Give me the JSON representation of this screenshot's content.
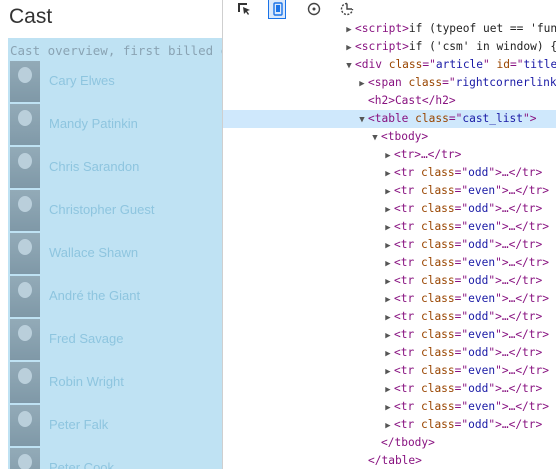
{
  "page": {
    "title": "Cast",
    "caption": "Cast overview, first billed only:",
    "cast": [
      {
        "name": "Cary Elwes"
      },
      {
        "name": "Mandy Patinkin"
      },
      {
        "name": "Chris Sarandon"
      },
      {
        "name": "Christopher Guest"
      },
      {
        "name": "Wallace Shawn"
      },
      {
        "name": "André the Giant"
      },
      {
        "name": "Fred Savage"
      },
      {
        "name": "Robin Wright"
      },
      {
        "name": "Peter Falk"
      },
      {
        "name": "Peter Cook"
      }
    ]
  },
  "devtools": {
    "toolbar": [
      "inspect-element-icon",
      "device-toolbar-icon",
      "performance-icon",
      "memory-icon"
    ],
    "nodes": [
      {
        "indent": 1,
        "expander": "closed",
        "open": "<script>",
        "text": "if (typeof uet == 'fun"
      },
      {
        "indent": 1,
        "expander": "closed",
        "open": "<script>",
        "text": "if ('csm' in window) {"
      },
      {
        "indent": 1,
        "expander": "open",
        "tag": "div",
        "attrs": [
          {
            "n": "class",
            "v": "article"
          },
          {
            "n": "id",
            "v": "title"
          }
        ],
        "trunc": true
      },
      {
        "indent": 2,
        "expander": "closed",
        "tag": "span",
        "attrs": [
          {
            "n": "class",
            "v": "rightcornerlink"
          }
        ],
        "trunc": true
      },
      {
        "indent": 2,
        "expander": "none",
        "raw": "<h2>Cast</h2>"
      },
      {
        "indent": 2,
        "expander": "open",
        "tag": "table",
        "attrs": [
          {
            "n": "class",
            "v": "cast_list"
          }
        ],
        "selected": true
      },
      {
        "indent": 3,
        "expander": "open",
        "raw": "<tbody>"
      },
      {
        "indent": 4,
        "expander": "closed",
        "raw": "<tr>…</tr>"
      },
      {
        "indent": 4,
        "expander": "closed",
        "tag": "tr",
        "attrs": [
          {
            "n": "class",
            "v": "odd"
          }
        ],
        "collapsed": true
      },
      {
        "indent": 4,
        "expander": "closed",
        "tag": "tr",
        "attrs": [
          {
            "n": "class",
            "v": "even"
          }
        ],
        "collapsed": true
      },
      {
        "indent": 4,
        "expander": "closed",
        "tag": "tr",
        "attrs": [
          {
            "n": "class",
            "v": "odd"
          }
        ],
        "collapsed": true
      },
      {
        "indent": 4,
        "expander": "closed",
        "tag": "tr",
        "attrs": [
          {
            "n": "class",
            "v": "even"
          }
        ],
        "collapsed": true
      },
      {
        "indent": 4,
        "expander": "closed",
        "tag": "tr",
        "attrs": [
          {
            "n": "class",
            "v": "odd"
          }
        ],
        "collapsed": true
      },
      {
        "indent": 4,
        "expander": "closed",
        "tag": "tr",
        "attrs": [
          {
            "n": "class",
            "v": "even"
          }
        ],
        "collapsed": true
      },
      {
        "indent": 4,
        "expander": "closed",
        "tag": "tr",
        "attrs": [
          {
            "n": "class",
            "v": "odd"
          }
        ],
        "collapsed": true
      },
      {
        "indent": 4,
        "expander": "closed",
        "tag": "tr",
        "attrs": [
          {
            "n": "class",
            "v": "even"
          }
        ],
        "collapsed": true
      },
      {
        "indent": 4,
        "expander": "closed",
        "tag": "tr",
        "attrs": [
          {
            "n": "class",
            "v": "odd"
          }
        ],
        "collapsed": true
      },
      {
        "indent": 4,
        "expander": "closed",
        "tag": "tr",
        "attrs": [
          {
            "n": "class",
            "v": "even"
          }
        ],
        "collapsed": true
      },
      {
        "indent": 4,
        "expander": "closed",
        "tag": "tr",
        "attrs": [
          {
            "n": "class",
            "v": "odd"
          }
        ],
        "collapsed": true
      },
      {
        "indent": 4,
        "expander": "closed",
        "tag": "tr",
        "attrs": [
          {
            "n": "class",
            "v": "even"
          }
        ],
        "collapsed": true
      },
      {
        "indent": 4,
        "expander": "closed",
        "tag": "tr",
        "attrs": [
          {
            "n": "class",
            "v": "odd"
          }
        ],
        "collapsed": true
      },
      {
        "indent": 4,
        "expander": "closed",
        "tag": "tr",
        "attrs": [
          {
            "n": "class",
            "v": "even"
          }
        ],
        "collapsed": true
      },
      {
        "indent": 4,
        "expander": "closed",
        "tag": "tr",
        "attrs": [
          {
            "n": "class",
            "v": "odd"
          }
        ],
        "collapsed": true
      },
      {
        "indent": 3,
        "expander": "none",
        "raw": "</tbody>"
      },
      {
        "indent": 2,
        "expander": "none",
        "raw": "</table>"
      }
    ]
  },
  "colors": {
    "highlight": "#bfe2f3",
    "selected_row": "#cfe8fc",
    "tag": "#881280",
    "attr_name": "#994500",
    "attr_value": "#1a1aa6"
  }
}
